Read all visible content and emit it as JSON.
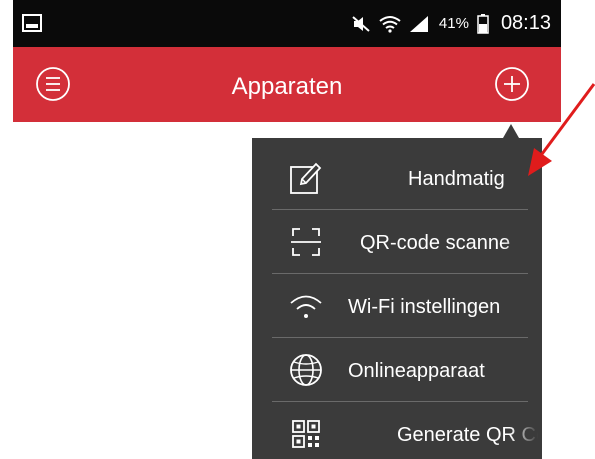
{
  "status_bar": {
    "battery_percent": "41%",
    "time": "08:13",
    "icons": [
      "gallery-icon",
      "mute-icon",
      "wifi-icon",
      "signal-icon",
      "battery-icon"
    ]
  },
  "app_bar": {
    "title": "Apparaten",
    "color": "#d32f39",
    "icons": [
      "menu-circle-icon",
      "add-circle-icon"
    ]
  },
  "dropdown_menu": {
    "background": "#3b3b3b",
    "items": [
      {
        "label": "Handmatig",
        "icon": "edit-icon"
      },
      {
        "label": "QR-code scanne",
        "icon": "scan-frame-icon"
      },
      {
        "label": "Wi-Fi instellingen",
        "icon": "wifi-icon"
      },
      {
        "label": "Onlineapparaat",
        "icon": "globe-icon"
      },
      {
        "label": "Generate QR Co",
        "icon": "qr-code-icon"
      }
    ]
  },
  "annotation": {
    "icon": "red-arrow-icon",
    "color": "#e01c1c"
  }
}
